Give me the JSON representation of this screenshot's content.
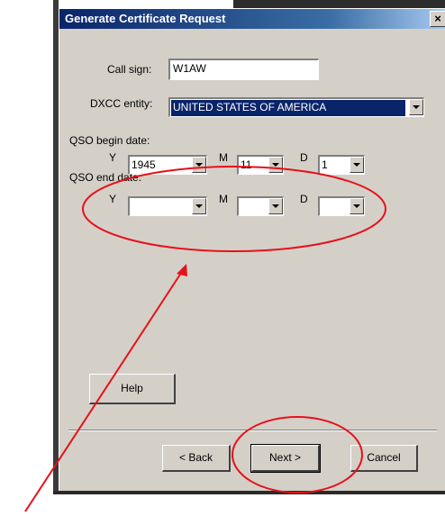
{
  "dialog": {
    "title": "Generate Certificate Request",
    "close_label": "×"
  },
  "form": {
    "call_sign_label": "Call sign:",
    "call_sign_value": "W1AW",
    "dxcc_label": "DXCC entity:",
    "dxcc_value": "UNITED STATES OF AMERICA",
    "begin_label": "QSO begin date:",
    "end_label": "QSO end date:",
    "y_label": "Y",
    "m_label": "M",
    "d_label": "D",
    "begin_year": "1945",
    "begin_month": "11",
    "begin_day": "1",
    "end_year": "",
    "end_month": "",
    "end_day": ""
  },
  "buttons": {
    "help": "Help",
    "back": "< Back",
    "next": "Next >",
    "cancel": "Cancel"
  },
  "colors": {
    "titlebar": "#0a246a",
    "dialog_bg": "#d4d0c8",
    "annotation": "#e8101a"
  }
}
